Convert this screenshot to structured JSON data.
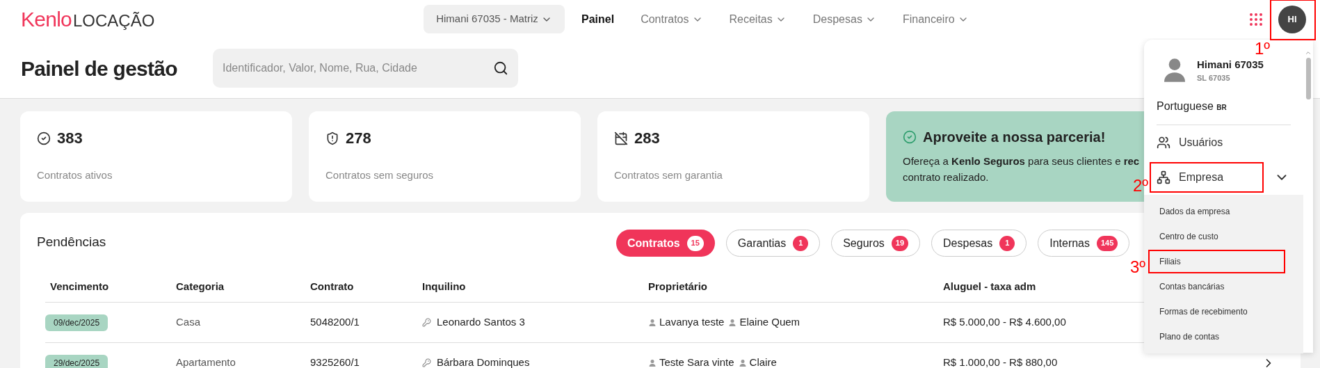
{
  "logo": {
    "brand": "Kenlo",
    "product": "LOCAÇÃO"
  },
  "header": {
    "company_select": "Himani 67035 - Matriz",
    "nav": [
      {
        "label": "Painel",
        "selected": true,
        "has_menu": false
      },
      {
        "label": "Contratos",
        "selected": false,
        "has_menu": true
      },
      {
        "label": "Receitas",
        "selected": false,
        "has_menu": true
      },
      {
        "label": "Despesas",
        "selected": false,
        "has_menu": true
      },
      {
        "label": "Financeiro",
        "selected": false,
        "has_menu": true
      }
    ],
    "avatar": {
      "initials": "HI",
      "annotation": "1º"
    }
  },
  "title": "Painel de gestão",
  "search": {
    "placeholder": "Identificador, Valor, Nome, Rua, Cidade"
  },
  "stats": [
    {
      "kind": "active",
      "value": "383",
      "label": "Contratos ativos"
    },
    {
      "kind": "no_insurance",
      "value": "278",
      "label": "Contratos sem seguros"
    },
    {
      "kind": "no_guarantee",
      "value": "283",
      "label": "Contratos sem garantia"
    }
  ],
  "promo": {
    "title": "Aproveite a nossa parceria!",
    "lines": [
      "Ofereça a **Kenlo Seguros** para seus clientes e **rec**",
      "contrato realizado."
    ]
  },
  "pending": {
    "title": "Pendências",
    "filters": [
      {
        "label": "Contratos",
        "count": "15",
        "selected": true
      },
      {
        "label": "Garantias",
        "count": "1",
        "selected": false
      },
      {
        "label": "Seguros",
        "count": "19",
        "selected": false
      },
      {
        "label": "Despesas",
        "count": "1",
        "selected": false
      },
      {
        "label": "Internas",
        "count": "145",
        "selected": false
      }
    ],
    "columns": [
      "Vencimento",
      "Categoria",
      "Contrato",
      "Inquilino",
      "Proprietário",
      "Aluguel - taxa adm"
    ],
    "rows": [
      {
        "due": "09/dec/2025",
        "category": "Casa",
        "contract": "5048200/1",
        "tenant": "Leonardo Santos 3",
        "owners": [
          "Lavanya teste",
          "Elaine Quem"
        ],
        "rent": "R$ 5.000,00 - R$ 4.600,00",
        "chevron_visible": false
      },
      {
        "due": "29/dec/2025",
        "category": "Apartamento",
        "contract": "9325260/1",
        "tenant": "Bárbara Dominques",
        "owners": [
          "Teste Sara vinte",
          "Claire"
        ],
        "rent": "R$ 1.000,00 - R$ 880,00",
        "chevron_visible": true
      }
    ]
  },
  "user_menu": {
    "name": "Himani 67035",
    "code": "SL 67035",
    "language": "Portuguese",
    "language_region": "BR",
    "items": [
      {
        "label": "Usuários",
        "kind": "users"
      },
      {
        "label": "Empresa",
        "kind": "company",
        "expanded": true,
        "annotation": "2º",
        "children": [
          {
            "label": "Dados da empresa"
          },
          {
            "label": "Centro de custo"
          },
          {
            "label": "Filiais",
            "annotation": "3º"
          },
          {
            "label": "Contas bancárias"
          },
          {
            "label": "Formas de recebimento"
          },
          {
            "label": "Plano de contas"
          }
        ]
      }
    ]
  }
}
